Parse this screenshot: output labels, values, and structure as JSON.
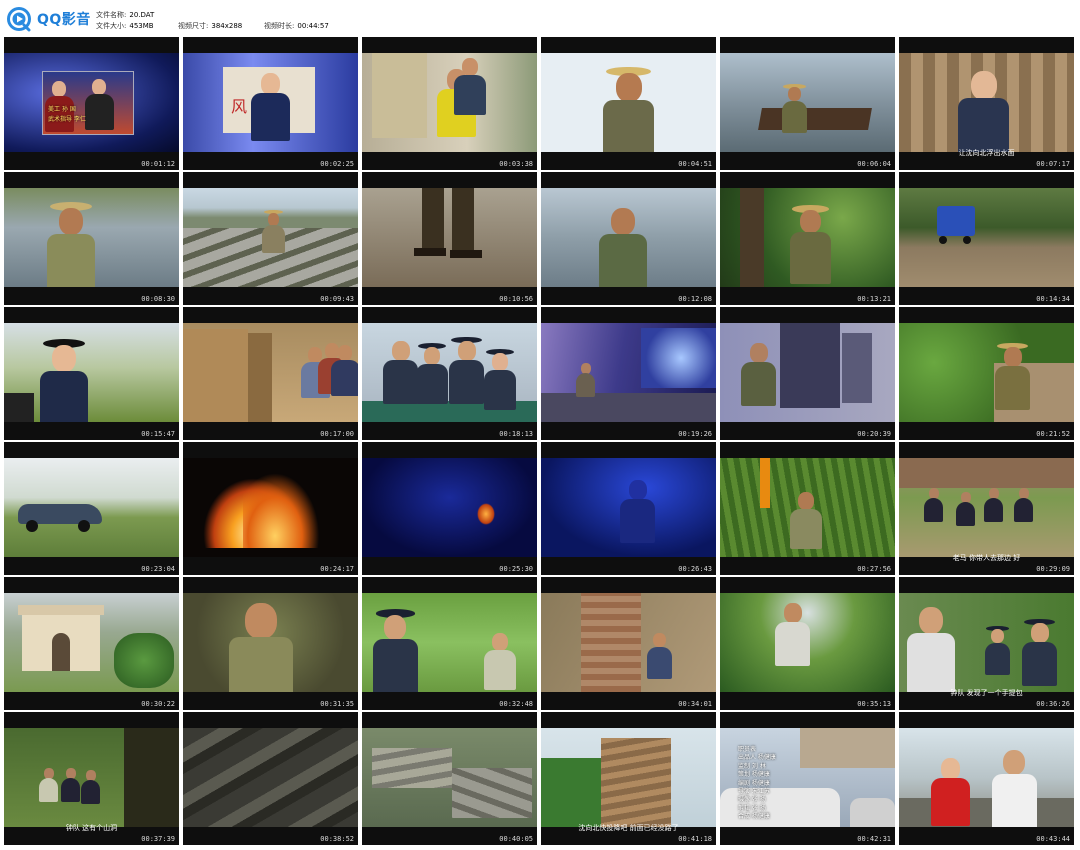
{
  "app": {
    "name": "QQ影音",
    "logo_icon": "qq-player-icon",
    "accent": "#1f7fd8"
  },
  "file_info": {
    "name_label": "文件名称:",
    "name_value": "20.DAT",
    "size_label": "文件大小:",
    "size_value": "453MB",
    "dims_label": "视频尺寸:",
    "dims_value": "384x288",
    "duration_label": "视频时长:",
    "duration_value": "00:44:57"
  },
  "thumbnails": [
    {
      "time": "00:01:12",
      "scene": "credits-night-blue",
      "overlay": [
        "美工 孙 国",
        "武术指导 李仁"
      ]
    },
    {
      "time": "00:02:25",
      "scene": "poster-officer",
      "overlay": [
        "风"
      ]
    },
    {
      "time": "00:03:38",
      "scene": "room-struggle"
    },
    {
      "time": "00:04:51",
      "scene": "man-hat-phone"
    },
    {
      "time": "00:06:04",
      "scene": "boats-lake"
    },
    {
      "time": "00:07:17",
      "scene": "policewoman-curtain",
      "subtitle": "让沈向北浮出水面"
    },
    {
      "time": "00:08:30",
      "scene": "man-washing"
    },
    {
      "time": "00:09:43",
      "scene": "stone-steps"
    },
    {
      "time": "00:10:56",
      "scene": "legs-gravel"
    },
    {
      "time": "00:12:08",
      "scene": "man-phone-lake"
    },
    {
      "time": "00:13:21",
      "scene": "man-hat-forest"
    },
    {
      "time": "00:14:34",
      "scene": "blue-truck-road"
    },
    {
      "time": "00:15:47",
      "scene": "policewoman-field"
    },
    {
      "time": "00:17:00",
      "scene": "people-wall"
    },
    {
      "time": "00:18:13",
      "scene": "police-table"
    },
    {
      "time": "00:19:26",
      "scene": "night-street"
    },
    {
      "time": "00:20:39",
      "scene": "man-doorway-blue"
    },
    {
      "time": "00:21:52",
      "scene": "man-hat-green"
    },
    {
      "time": "00:23:04",
      "scene": "car-grass"
    },
    {
      "time": "00:24:17",
      "scene": "fire"
    },
    {
      "time": "00:25:30",
      "scene": "dark-blue-fire"
    },
    {
      "time": "00:26:43",
      "scene": "dark-blue-figure"
    },
    {
      "time": "00:27:56",
      "scene": "cornfield-flag"
    },
    {
      "time": "00:29:09",
      "scene": "police-group-field",
      "subtitle": "老马  你带人去那边    好"
    },
    {
      "time": "00:30:22",
      "scene": "pagoda"
    },
    {
      "time": "00:31:35",
      "scene": "man-ground-close"
    },
    {
      "time": "00:32:48",
      "scene": "police-cap-field"
    },
    {
      "time": "00:34:01",
      "scene": "brick-ruins"
    },
    {
      "time": "00:35:13",
      "scene": "man-standing-forest"
    },
    {
      "time": "00:36:26",
      "scene": "police-three-forest",
      "subtitle": "钟队  发现了一个手提包"
    },
    {
      "time": "00:37:39",
      "scene": "cave-group",
      "subtitle": "钟队  这有个山洞"
    },
    {
      "time": "00:38:52",
      "scene": "dark-rocks"
    },
    {
      "time": "00:40:05",
      "scene": "rocks-grass"
    },
    {
      "time": "00:41:18",
      "scene": "rock-cliff-green",
      "subtitle": "沈向北快投降吧   前面已经没路了"
    },
    {
      "time": "00:42:31",
      "scene": "credits-cars",
      "overlay": [
        "职员表",
        "出品人  杨健康",
        "监制  刘 林",
        "策划  杨健康",
        "编剧  杨健康",
        "导演  朱江苏",
        "摄像  张 扬",
        "剪辑  张 扬",
        "合成  杨健康"
      ]
    },
    {
      "time": "00:43:44",
      "scene": "woman-officer-street"
    }
  ]
}
